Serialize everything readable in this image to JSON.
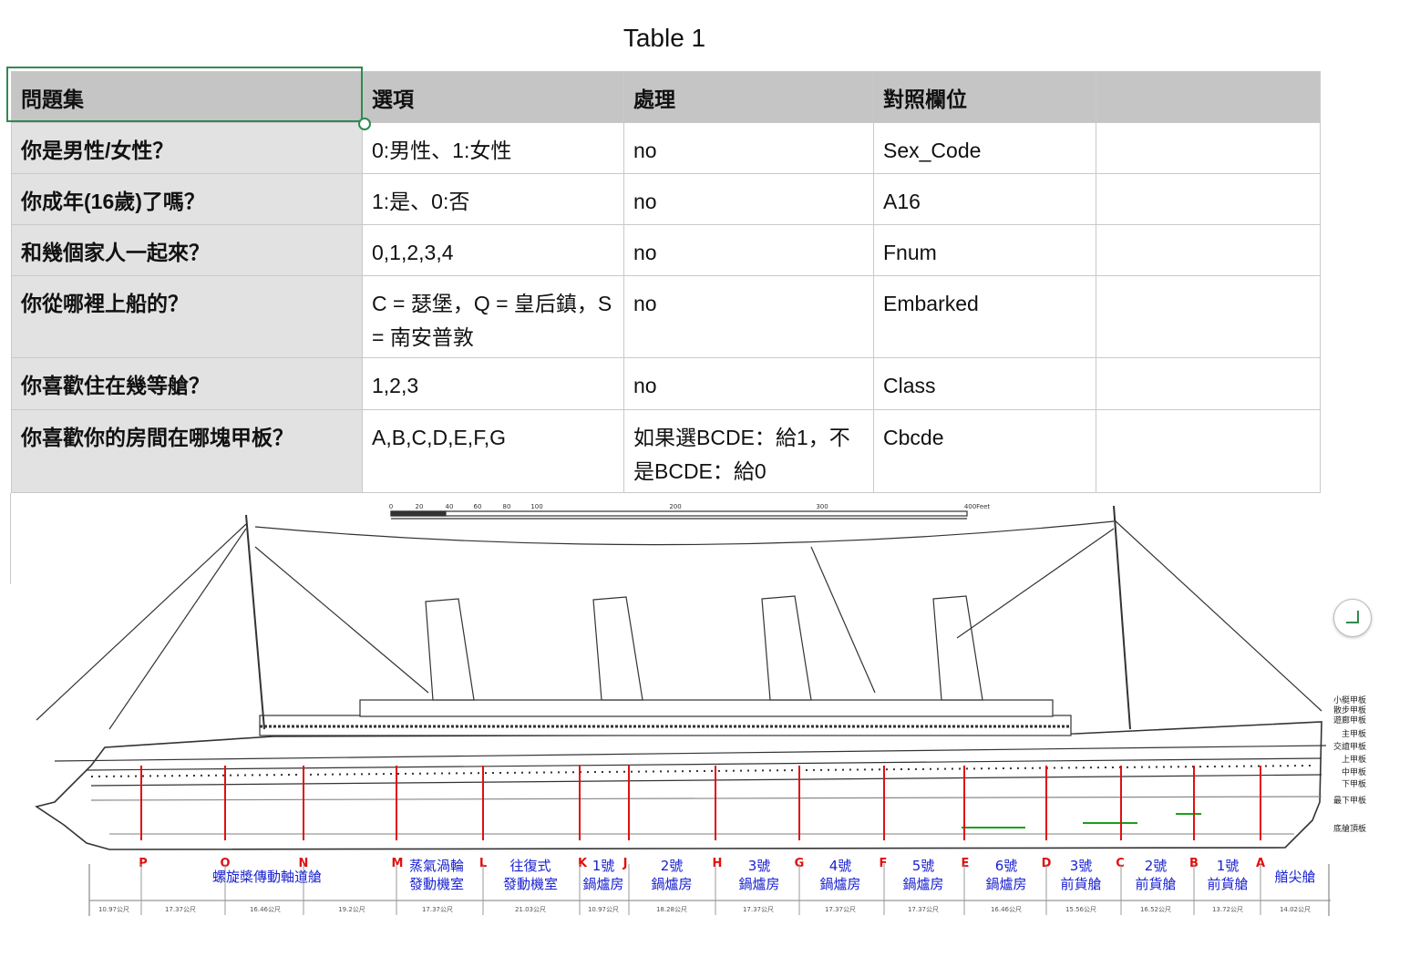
{
  "title": "Table 1",
  "table": {
    "headers": [
      "問題集",
      "選項",
      "處理",
      "對照欄位",
      ""
    ],
    "rows": [
      [
        "你是男性/女性？",
        "0:男性、1:女性",
        "no",
        "Sex_Code",
        ""
      ],
      [
        "你成年(16歲)了嗎？",
        "1:是、0:否",
        "no",
        "A16",
        ""
      ],
      [
        "和幾個家人一起來？",
        "0,1,2,3,4",
        "no",
        "Fnum",
        ""
      ],
      [
        "你從哪裡上船的？",
        "C = 瑟堡，Q = 皇后鎮，S = 南安普敦",
        "no",
        "Embarked",
        ""
      ],
      [
        "你喜歡住在幾等艙？",
        "1,2,3",
        "no",
        "Class",
        ""
      ],
      [
        "你喜歡你的房間在哪塊甲板？",
        "A,B,C,D,E,F,G",
        "如果選BCDE：給1，不是BCDE：給0",
        "Cbcde",
        ""
      ]
    ]
  },
  "diagram": {
    "scale_labels": [
      "0",
      "20",
      "40",
      "60",
      "80",
      "100",
      "200",
      "300",
      "400Feet"
    ],
    "deck_labels": [
      "小艇甲板",
      "散步甲板",
      "遊廊甲板",
      "主甲板",
      "交誼甲板",
      "上甲板",
      "中甲板",
      "下甲板",
      "最下甲板",
      "底艙頂板"
    ],
    "bulkhead_letters": [
      "P",
      "O",
      "N",
      "M",
      "L",
      "K",
      "J",
      "H",
      "G",
      "F",
      "E",
      "D",
      "C",
      "B",
      "A"
    ],
    "compartments": [
      [
        "螺旋槳傳動軸道艙"
      ],
      [
        "蒸氣渦輪",
        "發動機室"
      ],
      [
        "往復式",
        "發動機室"
      ],
      [
        "1號",
        "鍋爐房"
      ],
      [
        "2號",
        "鍋爐房"
      ],
      [
        "3號",
        "鍋爐房"
      ],
      [
        "4號",
        "鍋爐房"
      ],
      [
        "5號",
        "鍋爐房"
      ],
      [
        "6號",
        "鍋爐房"
      ],
      [
        "3號",
        "前貨艙"
      ],
      [
        "2號",
        "前貨艙"
      ],
      [
        "1號",
        "前貨艙"
      ],
      [
        "艏尖艙"
      ]
    ],
    "lengths": [
      "10.97公尺",
      "17.37公尺",
      "16.46公尺",
      "19.2公尺",
      "17.37公尺",
      "21.03公尺",
      "10.97公尺",
      "18.28公尺",
      "17.37公尺",
      "17.37公尺",
      "17.37公尺",
      "16.46公尺",
      "15.56公尺",
      "16.52公尺",
      "13.72公尺",
      "14.02公尺"
    ],
    "colors": {
      "bulkhead": "#e01010",
      "compartment": "#1a22d0",
      "selection": "#2f8a4f"
    }
  }
}
